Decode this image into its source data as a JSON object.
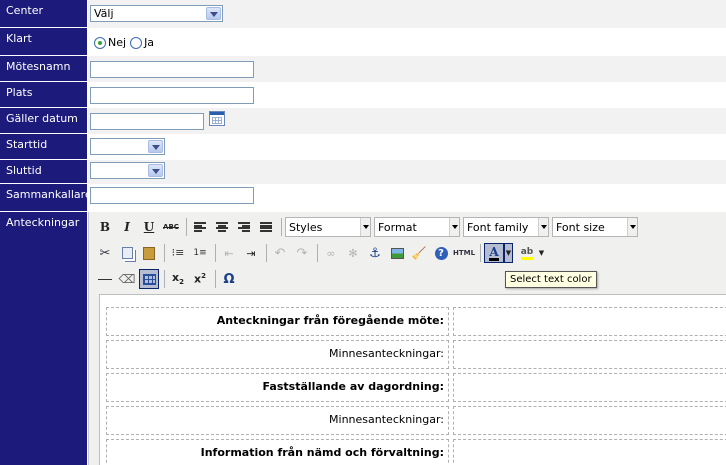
{
  "form": {
    "center": {
      "label": "Center",
      "value": "Välj"
    },
    "klart": {
      "label": "Klart",
      "options": [
        "Nej",
        "Ja"
      ],
      "selected": "Nej"
    },
    "motesnamn": {
      "label": "Mötesnamn",
      "value": ""
    },
    "plats": {
      "label": "Plats",
      "value": ""
    },
    "galler_datum": {
      "label": "Gäller datum",
      "value": ""
    },
    "starttid": {
      "label": "Starttid",
      "value": ""
    },
    "sluttid": {
      "label": "Sluttid",
      "value": ""
    },
    "sammankallare": {
      "label": "Sammankallare",
      "value": ""
    },
    "anteckningar": {
      "label": "Anteckningar"
    }
  },
  "editor": {
    "toolbar1": {
      "bold": "B",
      "italic": "I",
      "underline": "U",
      "strike": "ABC",
      "styles": "Styles",
      "format": "Format",
      "font_family": "Font family",
      "font_size": "Font size"
    },
    "toolbar2": {
      "html": "HTML"
    },
    "toolbar3": {
      "omega": "Ω"
    },
    "tooltip": "Select text color",
    "rows": [
      {
        "label": "Anteckningar från föregående möte:",
        "bold": true
      },
      {
        "label": "Minnesanteckningar:",
        "bold": false
      },
      {
        "label": "Fastställande av dagordning:",
        "bold": true
      },
      {
        "label": "Minnesanteckningar:",
        "bold": false
      },
      {
        "label": "Information från nämd och förvaltning:",
        "bold": true
      }
    ]
  },
  "colors": {
    "label_bg": "#1c1a7a",
    "alt_row_bg": "#f2f2f2",
    "editor_bg": "#f0f0ee"
  }
}
